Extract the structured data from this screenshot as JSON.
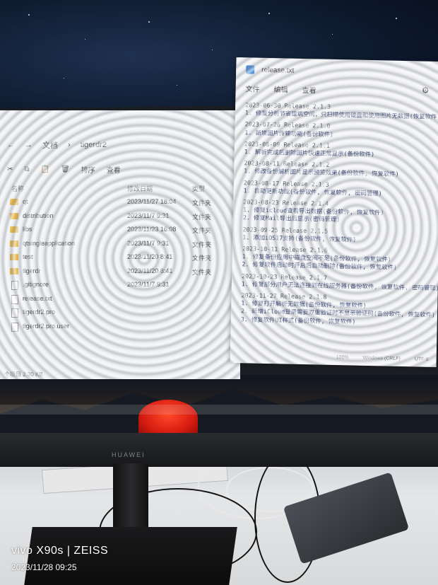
{
  "explorer": {
    "path": [
      "文档",
      "tigerdr2"
    ],
    "toolbar": [
      "排序",
      "查看"
    ],
    "columns": [
      "名称",
      "修改日期",
      "类型"
    ],
    "rows": [
      {
        "name": "qt",
        "date": "2023/11/27 18:04",
        "type": "文件夹",
        "kind": "folder"
      },
      {
        "name": "distribution",
        "date": "2023/11/7 9:31",
        "type": "文件夹",
        "kind": "folder"
      },
      {
        "name": "libs",
        "date": "2023/11/23 16:08",
        "type": "文件夹",
        "kind": "folder"
      },
      {
        "name": "qtsingleapplication",
        "date": "2023/11/7 9:31",
        "type": "文件夹",
        "kind": "folder"
      },
      {
        "name": "test",
        "date": "2023/11/20 8:41",
        "type": "文件夹",
        "kind": "folder"
      },
      {
        "name": "tigerdr",
        "date": "2023/11/20 8:41",
        "type": "文件夹",
        "kind": "folder"
      },
      {
        "name": ".gitignore",
        "date": "2023/11/7 9:31",
        "type": "",
        "kind": "file"
      },
      {
        "name": "release.txt",
        "date": "",
        "type": "",
        "kind": "file"
      },
      {
        "name": "tigerdr2.pro",
        "date": "",
        "type": "",
        "kind": "file"
      },
      {
        "name": "tigerdr2.pro.user",
        "date": "",
        "type": "",
        "kind": "file"
      }
    ],
    "status": "个项目  2.30 KB"
  },
  "notepad": {
    "title": "release.txt",
    "menu": [
      "文件",
      "编辑",
      "查看"
    ],
    "lines": [
      {
        "text": "2023-06-30 Release 2.1.3",
        "heading": true
      },
      {
        "text": "1. 修复分析节省建筑空间，只扫描使用硬盘和使用图片无数据(恢复软件)",
        "heading": false
      },
      {
        "text": "2023-07-26 Release 2.1.0",
        "heading": true
      },
      {
        "text": "1. 新增图片传输功能(备份软件)",
        "heading": false
      },
      {
        "text": "2023-08-09 Release 2.1.1",
        "heading": true
      },
      {
        "text": "1. 解析完成后删除图片快速正常显示(备份软件)",
        "heading": false
      },
      {
        "text": "2023-08-11 Release 2.1.2",
        "heading": true
      },
      {
        "text": "1. 修改备份解析图片显示预览效果(备份软件, 恢复软件)",
        "heading": false
      },
      {
        "text": "2023-08-17 Release 2.1.3",
        "heading": true
      },
      {
        "text": "1. 自动更新功能(备份软件, 恢复软件, 密码管理)",
        "heading": false
      },
      {
        "text": "2023-08-23 Release 2.1.4",
        "heading": true
      },
      {
        "text": "1. 修复icloud查看导出数据(备份软件, 恢复软件)",
        "heading": false
      },
      {
        "text": "2. 修复Mail导出后显示(密码管理)",
        "heading": false
      },
      {
        "text": "2023-09-25 Release 2.1.5",
        "heading": true
      },
      {
        "text": "1. 添加iOS17支持(备份软件, 恢复软件)",
        "heading": false
      },
      {
        "text": "2023-10-11 Release 2.1.6",
        "heading": true
      },
      {
        "text": "1. 修复备份应用中磁盘空间不足(备份软件, 恢复软件)",
        "heading": false
      },
      {
        "text": "2. 修复软件启动时开启后自动删除(备份软件, 恢复软件)",
        "heading": false
      },
      {
        "text": "2023-10-23 Release 2.1.7",
        "heading": true
      },
      {
        "text": "1. 修复部分用户无法连接到在线服务器(备份软件, 恢复软件, 密码管理)",
        "heading": false
      },
      {
        "text": "2023-11-27 Release 2.1.8",
        "heading": true
      },
      {
        "text": "1. 修复打开解析无数据(备份软件, 恢复软件)",
        "heading": false
      },
      {
        "text": "2. 新增iCloud登录需要双重验证时不显示验证码(备份软件, 恢复软件)",
        "heading": false
      },
      {
        "text": "3. 修复软件UI样式(备份软件, 恢复软件)",
        "heading": false
      }
    ],
    "status": [
      "100%",
      "Windows (CRLF)",
      "UTF-8"
    ]
  },
  "monitor_brand": "HUAWEI",
  "watermark": {
    "line1": "vivo X90s | ZEISS",
    "line2": "2023/11/28 09:25"
  }
}
